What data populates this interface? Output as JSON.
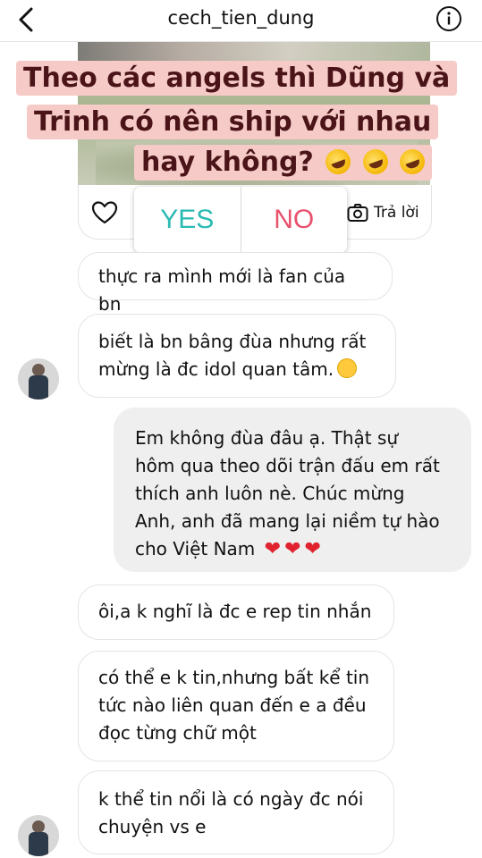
{
  "header": {
    "title": "cech_tien_dung",
    "back_icon": "chevron-left-icon",
    "info_icon": "info-circle-icon"
  },
  "story": {
    "question_lines": [
      "Theo các angels thì Dũng và",
      "Trinh có nên ship với nhau",
      "hay không?"
    ],
    "question_emoji": "rolling-on-floor-laughing-emoji",
    "poll": {
      "yes": "YES",
      "no": "NO"
    },
    "reply_label": "Trả lời",
    "like_icon": "heart-outline-icon",
    "camera_icon": "camera-icon"
  },
  "messages": [
    {
      "side": "left",
      "lines": [
        "thực ra mình mới là fan của bn"
      ]
    },
    {
      "side": "left",
      "lines": [
        "biết là bn bâng đùa nhưng rất",
        "mừng là đc idol quan tâm."
      ],
      "emoji": "smiling-face-emoji"
    },
    {
      "side": "right",
      "lines": [
        "Em không đùa đâu ạ. Thật sự",
        "hôm qua theo dõi trận đấu em rất",
        "thích anh luôn nè. Chúc mừng",
        "Anh, anh đã mang lại niềm tự hào",
        "cho Việt Nam"
      ],
      "emoji": "red-heart-emoji"
    },
    {
      "side": "left",
      "lines": [
        "ôi,a k nghĩ là đc e rep tin nhắn"
      ]
    },
    {
      "side": "left",
      "lines": [
        "có thể e k tin,nhưng bất kể tin",
        "tức nào liên quan đến e a đều",
        "đọc từng chữ một"
      ]
    },
    {
      "side": "left",
      "lines": [
        "k thể tin nổi là có ngày đc nói",
        "chuyện vs e"
      ]
    }
  ],
  "colors": {
    "poll_yes": "#2bbab3",
    "poll_no": "#e8506b",
    "question_text": "#4a1418",
    "question_bg": "#f6cbc7",
    "sent_bubble": "#efefef",
    "heart": "#e0232e"
  }
}
